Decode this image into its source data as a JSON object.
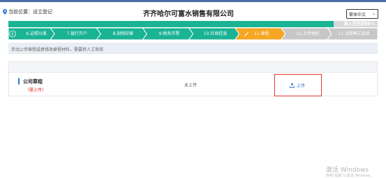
{
  "header": {
    "location_label": "当前位置：设立登记",
    "company_title": "齐齐哈尔可富水销售有限公司",
    "language": "繁体中文"
  },
  "progress": {
    "value": 0.88,
    "text": "录入已完成88%"
  },
  "steps": [
    {
      "label": "6.证照分离",
      "state": "done"
    },
    {
      "label": "7.银行开户",
      "state": "done"
    },
    {
      "label": "8.刻制印章",
      "state": "done"
    },
    {
      "label": "9.税务开票",
      "state": "done"
    },
    {
      "label": "10.社保信息",
      "state": "done"
    },
    {
      "label": "11.章程",
      "state": "current"
    },
    {
      "label": "12.上传材料",
      "state": "todo"
    },
    {
      "label": "13.流程模式选择",
      "state": "todo"
    }
  ],
  "colors": {
    "done": "#1ab394",
    "current": "#f5a623",
    "todo": "#c7c7c7",
    "accent": "#2b6cc4",
    "required": "#e02020"
  },
  "notice": "手动上传章程或者修改章程材料，需要转人工审核",
  "documents": [
    {
      "name": "公司章程",
      "required_label": "（需上传）",
      "status": "未上传",
      "action": "上传"
    }
  ],
  "watermark": {
    "line1": "激活 Windows",
    "line2": "转到\"设置\"以激活 Windows。"
  }
}
